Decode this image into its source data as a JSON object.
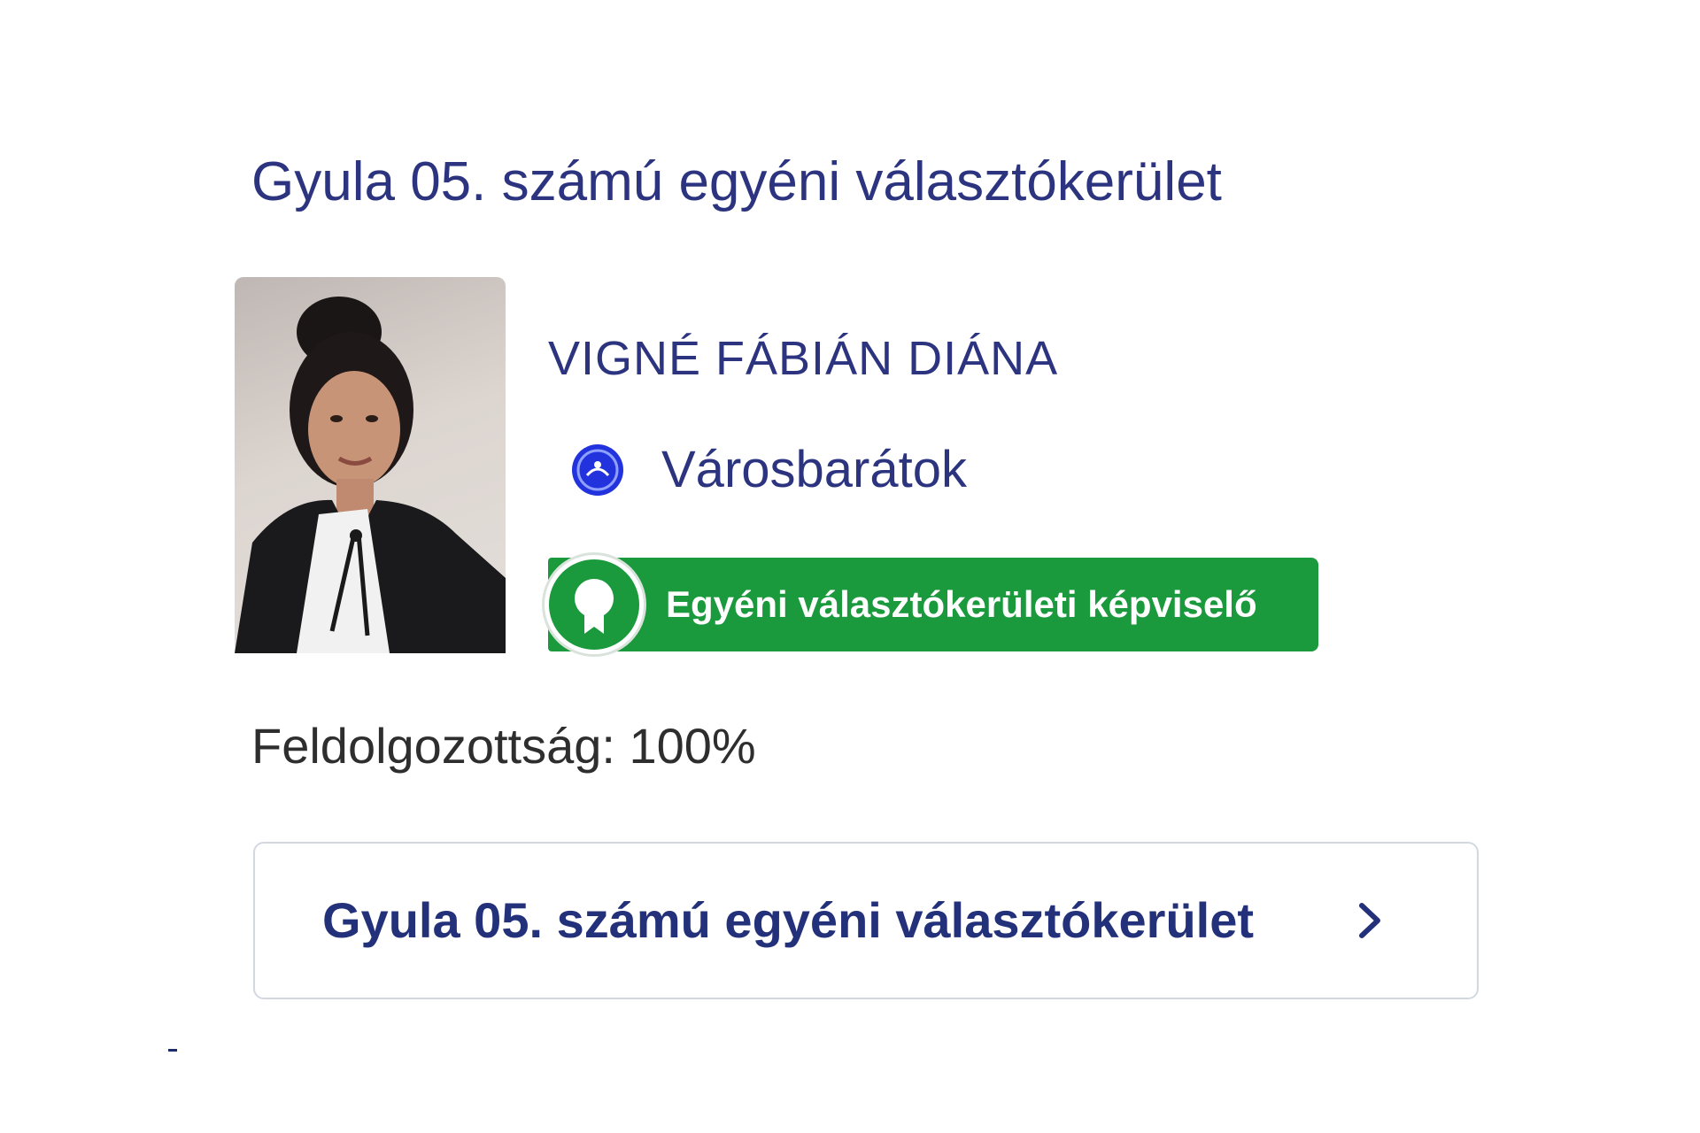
{
  "district": {
    "title": "Gyula 05. számú egyéni választókerület"
  },
  "candidate": {
    "photo": "candidate-portrait-photo",
    "name": "VIGNÉ FÁBIÁN DIÁNA",
    "party": {
      "name": "Városbarátok",
      "logo_icon": "party-logo-icon",
      "logo_color": "#2233dd"
    },
    "badge": {
      "label": "Egyéni választókerületi képviselő",
      "icon": "award-medal-icon",
      "color": "#1a9a3c"
    }
  },
  "progress": {
    "label": "Feldolgozottság: 100%"
  },
  "link": {
    "label": "Gyula 05. számú egyéni választókerület",
    "icon": "chevron-right-icon"
  },
  "colors": {
    "title_text": "#2c3480",
    "link_text": "#23307a",
    "badge_green": "#1a9a3c",
    "border": "#d3d8e0"
  }
}
